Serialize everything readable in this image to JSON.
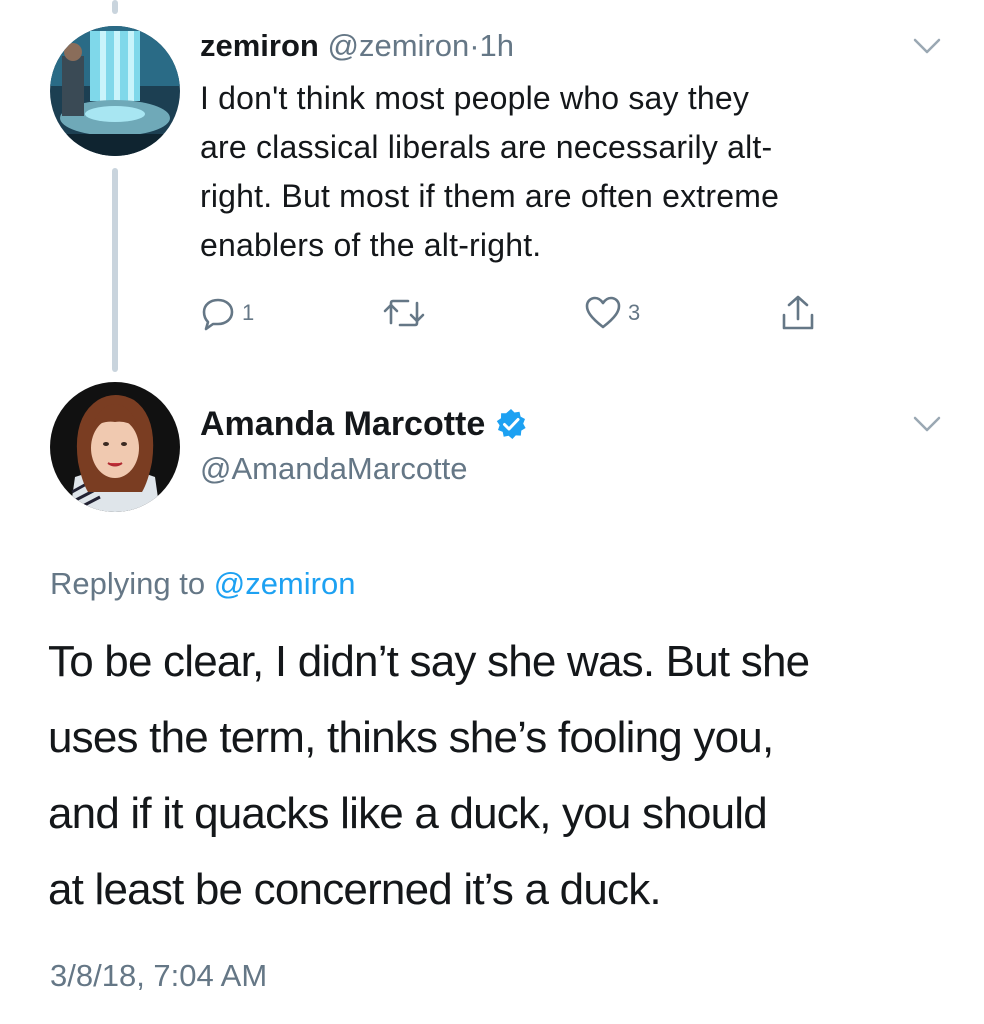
{
  "reply_tweet": {
    "author_name": "zemiron",
    "handle": "@zemiron",
    "separator": "·",
    "time": "1h",
    "text": "I don't think most people who say they\nare classical liberals are necessarily alt-\nright. But most if them are often extreme\nenablers of the alt-right.",
    "actions": {
      "reply_count": "1",
      "like_count": "3"
    }
  },
  "main_tweet": {
    "author_name": "Amanda Marcotte",
    "handle": "@AmandaMarcotte",
    "verified": true,
    "replying_prefix": "Replying to",
    "replying_to": "@zemiron",
    "text": "To be clear, I didn’t say she was. But she\nuses the term, thinks she’s fooling you,\nand if it quacks like a duck, you should\nat least be concerned it’s a duck.",
    "timestamp": "3/8/18, 7:04 AM"
  },
  "icons": {
    "reply": "reply-icon",
    "retweet": "retweet-icon",
    "like": "heart-icon",
    "share": "share-icon",
    "menu": "chevron-down-icon",
    "verified": "verified-badge-icon"
  },
  "colors": {
    "accent": "#1da1f2",
    "text": "#14171a",
    "secondary": "#657786",
    "thread_line": "#c9d4dd"
  }
}
